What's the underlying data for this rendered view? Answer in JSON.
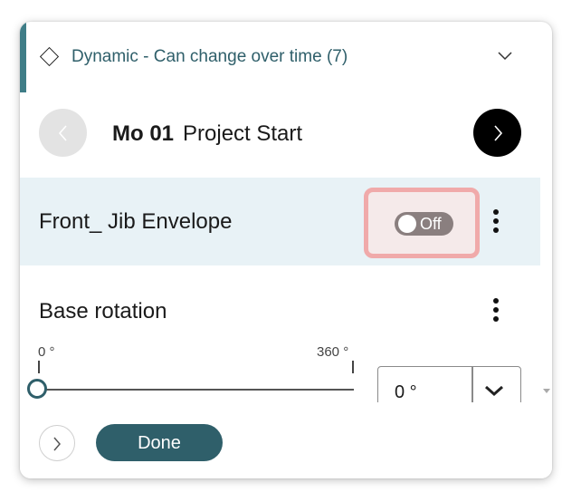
{
  "header": {
    "title": "Dynamic - Can change over time (7)"
  },
  "milestone": {
    "code": "Mo 01",
    "name": "Project Start"
  },
  "envelope": {
    "label": "Front_ Jib Envelope",
    "toggle_text": "Off",
    "toggle_state": false
  },
  "rotation": {
    "label": "Base rotation",
    "min_label": "0 °",
    "max_label": "360 °",
    "slider_value": 0,
    "selected": "0 °"
  },
  "footer": {
    "done_label": "Done"
  },
  "colors": {
    "accent": "#3f7d87",
    "primary": "#2f5f6a",
    "highlight_border": "#f0aaaa",
    "row_bg": "#e8f2f6"
  }
}
